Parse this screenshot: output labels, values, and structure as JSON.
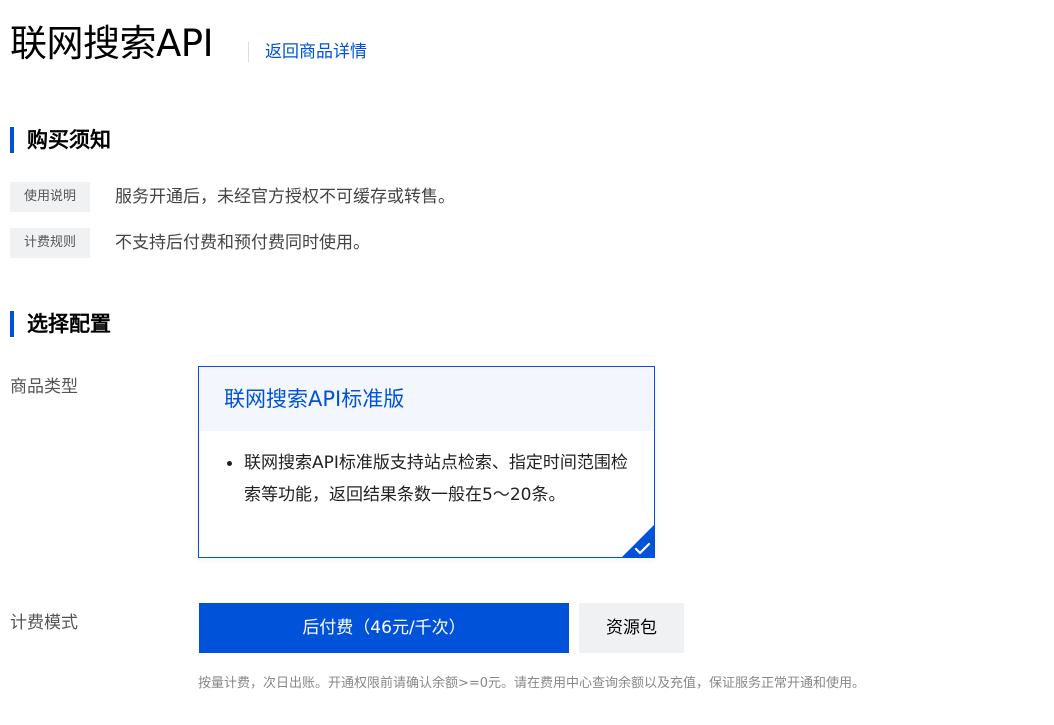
{
  "header": {
    "title": "联网搜索API",
    "back_link": "返回商品详情"
  },
  "purchase_notice": {
    "title": "购买须知",
    "items": [
      {
        "tag": "使用说明",
        "text": "服务开通后，未经官方授权不可缓存或转售。"
      },
      {
        "tag": "计费规则",
        "text": "不支持后付费和预付费同时使用。"
      }
    ]
  },
  "config": {
    "title": "选择配置",
    "product_type": {
      "label": "商品类型",
      "card": {
        "title": "联网搜索API标准版",
        "bullets": [
          "联网搜索API标准版支持站点检索、指定时间范围检索等功能，返回结果条数一般在5～20条。"
        ],
        "selected": true
      }
    },
    "billing_mode": {
      "label": "计费模式",
      "options": [
        {
          "label": "后付费（46元/千次）",
          "selected": true
        },
        {
          "label": "资源包",
          "selected": false
        }
      ],
      "hint": "按量计费，次日出账。开通权限前请确认余额>=0元。请在费用中心查询余额以及充值，保证服务正常开通和使用。"
    }
  },
  "colors": {
    "accent": "#0052d9",
    "card_header_bg": "#f3f7fd",
    "tag_bg": "#f0f1f3"
  }
}
